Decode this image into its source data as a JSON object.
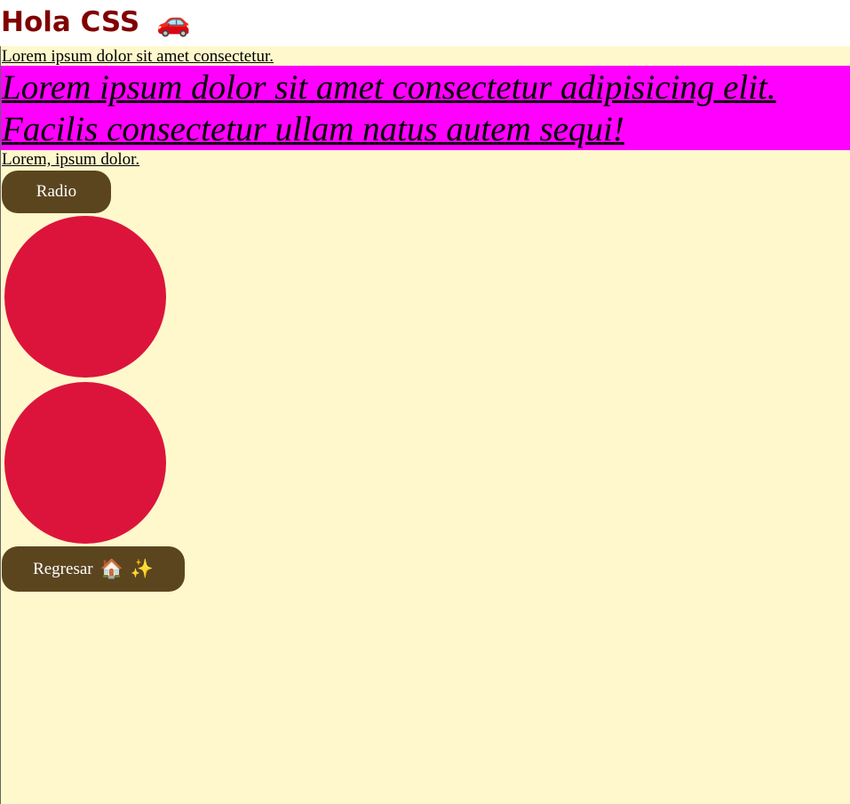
{
  "header": {
    "title": "Hola CSS",
    "title_icon": "🚗",
    "title_color": "#800000"
  },
  "content": {
    "background_color": "#fff8cc",
    "top_link": "Lorem ipsum dolor sit amet consectetur.",
    "big_link": "Lorem ipsum dolor sit amet consectetur adipisicing elit. Facilis consectetur ullam natus autem sequi!",
    "big_link_background": "#ff00ff",
    "small_link": "Lorem, ipsum dolor.",
    "radio_button": "Radio",
    "circles": [
      {
        "name": "red-circle",
        "color": "#dc143c"
      },
      {
        "name": "red-circle",
        "color": "#dc143c"
      }
    ],
    "back_button": {
      "label": "Regresar",
      "icon_home": "🏠",
      "icon_sparkles": "✨"
    },
    "button_color": "#5b451f"
  },
  "icons": {
    "car": "car-icon",
    "home": "home-icon",
    "sparkles": "sparkles-icon"
  }
}
